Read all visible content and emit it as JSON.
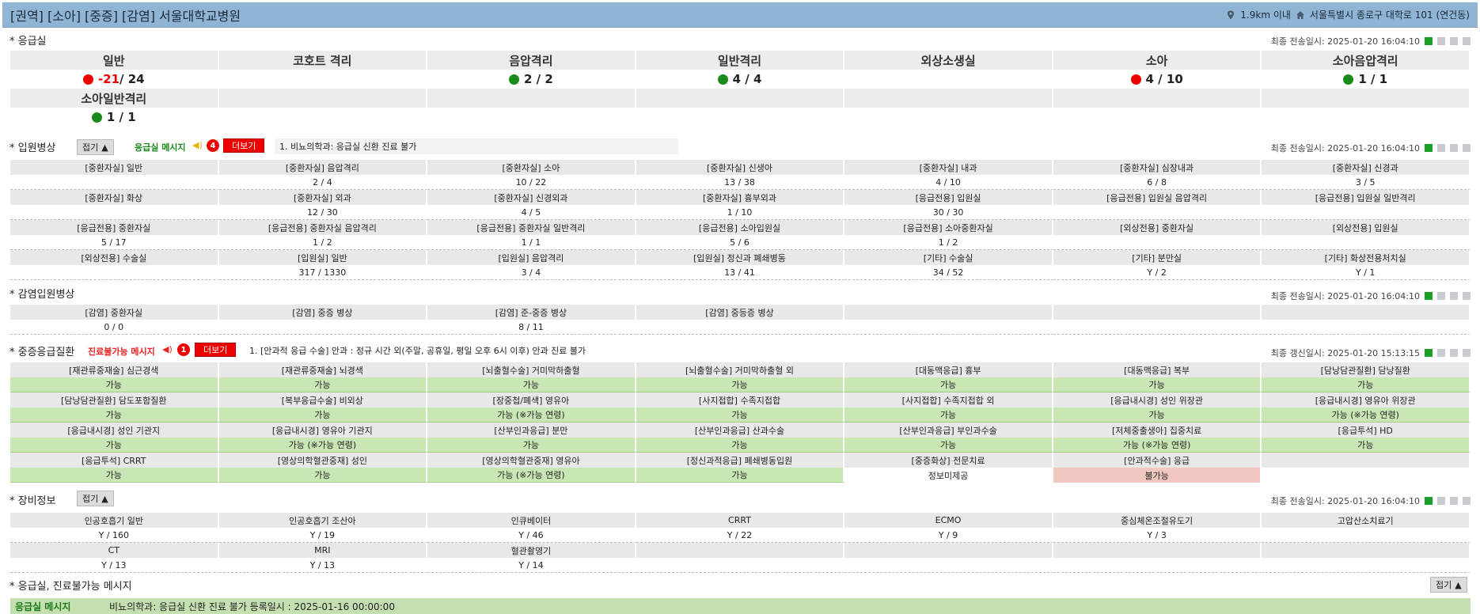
{
  "header": {
    "title": "[권역] [소아] [중증] [감염] 서울대학교병원",
    "distance": "1.9km 이내",
    "address": "서울특별시 종로구 대학로 101 (연건동)"
  },
  "er": {
    "title": "* 응급실",
    "meta": "최종 전송일시: 2025-01-20 16:04:10",
    "row1": [
      {
        "label": "일반",
        "status": "red",
        "value": "-21",
        "total": " / 24",
        "neg": true
      },
      {
        "label": "코호트 격리",
        "status": "",
        "value": "",
        "total": ""
      },
      {
        "label": "음압격리",
        "status": "green",
        "value": "2 / 2",
        "total": ""
      },
      {
        "label": "일반격리",
        "status": "green",
        "value": "4 / 4",
        "total": ""
      },
      {
        "label": "외상소생실",
        "status": "",
        "value": "",
        "total": ""
      },
      {
        "label": "소아",
        "status": "red",
        "value": "4 / 10",
        "total": ""
      },
      {
        "label": "소아음압격리",
        "status": "green",
        "value": "1 / 1",
        "total": ""
      }
    ],
    "row2": [
      {
        "label": "소아일반격리",
        "status": "green",
        "value": "1 / 1"
      }
    ]
  },
  "ward": {
    "title": "* 입원병상",
    "fold": "접기",
    "msg_label": "응급실 메시지",
    "msg_count": "4",
    "more": "더보기",
    "msg_text": "1. 비뇨의학과: 응급실 신환 진료 불가",
    "meta": "최종 전송일시: 2025-01-20 16:04:10",
    "rows": [
      {
        "labels": [
          "[중환자실] 일반",
          "[중환자실] 음압격리",
          "[중환자실] 소아",
          "[중환자실] 신생아",
          "[중환자실] 내과",
          "[중환자실] 심장내과",
          "[중환자실] 신경과"
        ],
        "values": [
          "",
          "2 / 4",
          "10 / 22",
          "13 / 38",
          "4 / 10",
          "6 / 8",
          "3 / 5"
        ]
      },
      {
        "labels": [
          "[중환자실] 화상",
          "[중환자실] 외과",
          "[중환자실] 신경외과",
          "[중환자실] 흉부외과",
          "[응급전용] 입원실",
          "[응급전용] 입원실 음압격리",
          "[응급전용] 입원실 일반격리"
        ],
        "values": [
          "",
          "12 / 30",
          "4 / 5",
          "1 / 10",
          "30 / 30",
          "",
          ""
        ]
      },
      {
        "labels": [
          "[응급전용] 중환자실",
          "[응급전용] 중환자실 음압격리",
          "[응급전용] 중환자실 일반격리",
          "[응급전용] 소아입원실",
          "[응급전용] 소아중환자실",
          "[외상전용] 중환자실",
          "[외상전용] 입원실"
        ],
        "values": [
          "5 / 17",
          "1 / 2",
          "1 / 1",
          "5 / 6",
          "1 / 2",
          "",
          ""
        ]
      },
      {
        "labels": [
          "[외상전용] 수술실",
          "[입원실] 일반",
          "[입원실] 음압격리",
          "[입원실] 정신과 폐쇄병동",
          "[기타] 수술실",
          "[기타] 분만실",
          "[기타] 화상전용처치실"
        ],
        "values": [
          "",
          "317 / 1330",
          "3 / 4",
          "13 / 41",
          "34 / 52",
          "Y / 2",
          "Y / 1"
        ]
      }
    ]
  },
  "infect": {
    "title": "* 감염입원병상",
    "meta": "최종 전송일시: 2025-01-20 16:04:10",
    "labels": [
      "[감염] 중환자실",
      "[감염] 중증 병상",
      "[감염] 준-중증 병상",
      "[감염] 중등증 병상",
      "",
      "",
      ""
    ],
    "values": [
      "0 / 0",
      "",
      "8 / 11",
      "",
      "",
      "",
      ""
    ]
  },
  "severe": {
    "title": "* 중증응급질환",
    "msg_label": "진료불가능 메시지",
    "msg_count": "1",
    "more": "더보기",
    "msg_text": "1. [안과적 응급 수술] 안과 : 정규 시간 외(주말, 공휴일, 평일 오후 6시 이후) 안과 진료 불가",
    "meta": "최종 갱신일시: 2025-01-20 15:13:15",
    "rows": [
      {
        "labels": [
          "[재관류중재술] 심근경색",
          "[재관류중재술] 뇌경색",
          "[뇌출혈수술] 거미막하출혈",
          "[뇌출혈수술] 거미막하출혈 외",
          "[대동맥응급] 흉부",
          "[대동맥응급] 복부",
          "[담낭담관질환] 담낭질환"
        ],
        "values": [
          "가능",
          "가능",
          "가능",
          "가능",
          "가능",
          "가능",
          "가능"
        ],
        "states": [
          "ok",
          "ok",
          "ok",
          "ok",
          "ok",
          "ok",
          "ok"
        ]
      },
      {
        "labels": [
          "[담낭담관질환] 담도포함질환",
          "[복부응급수술] 비외상",
          "[장중첩/폐색] 영유아",
          "[사지접합] 수족지접합",
          "[사지접합] 수족지접합 외",
          "[응급내시경] 성인 위장관",
          "[응급내시경] 영유아 위장관"
        ],
        "values": [
          "가능",
          "가능",
          "가능 (※가능 연령)",
          "가능",
          "가능",
          "가능",
          "가능 (※가능 연령)"
        ],
        "states": [
          "ok",
          "ok",
          "ok",
          "ok",
          "ok",
          "ok",
          "ok"
        ]
      },
      {
        "labels": [
          "[응급내시경] 성인 기관지",
          "[응급내시경] 영유아 기관지",
          "[산부인과응급] 분만",
          "[산부인과응급] 산과수술",
          "[산부인과응급] 부인과수술",
          "[저체중출생아] 집중치료",
          "[응급투석] HD"
        ],
        "values": [
          "가능",
          "가능 (※가능 연령)",
          "가능",
          "가능",
          "가능",
          "가능 (※가능 연령)",
          "가능"
        ],
        "states": [
          "ok",
          "ok",
          "ok",
          "ok",
          "ok",
          "ok",
          "ok"
        ]
      },
      {
        "labels": [
          "[응급투석] CRRT",
          "[영상의학혈관중재] 성인",
          "[영상의학혈관중재] 영유아",
          "[정신과적응급] 폐쇄병동입원",
          "[중증화상] 전문치료",
          "[안과적수술] 응급",
          ""
        ],
        "values": [
          "가능",
          "가능",
          "가능 (※가능 연령)",
          "가능",
          "정보미제공",
          "불가능",
          ""
        ],
        "states": [
          "ok",
          "ok",
          "ok",
          "ok",
          "plain",
          "bad",
          "plain"
        ]
      }
    ]
  },
  "equip": {
    "title": "* 장비정보",
    "fold": "접기",
    "meta": "최종 전송일시: 2025-01-20 16:04:10",
    "rows": [
      {
        "labels": [
          "인공호흡기 일반",
          "인공호흡기 조산아",
          "인큐베이터",
          "CRRT",
          "ECMO",
          "중심체온조절유도기",
          "고압산소치료기"
        ],
        "values": [
          "Y / 160",
          "Y / 19",
          "Y / 46",
          "Y / 22",
          "Y / 9",
          "Y / 3",
          ""
        ]
      },
      {
        "labels": [
          "CT",
          "MRI",
          "혈관촬영기",
          "",
          "",
          "",
          ""
        ],
        "values": [
          "Y / 13",
          "Y / 13",
          "Y / 14",
          "",
          "",
          "",
          ""
        ]
      }
    ]
  },
  "messages": {
    "title": "* 응급실, 진료불가능 메시지",
    "fold": "접기",
    "row_label": "응급실 메시지",
    "row_text": "비뇨의학과: 응급실 신환 진료 불가 등록일시 : 2025-01-16 00:00:00"
  }
}
